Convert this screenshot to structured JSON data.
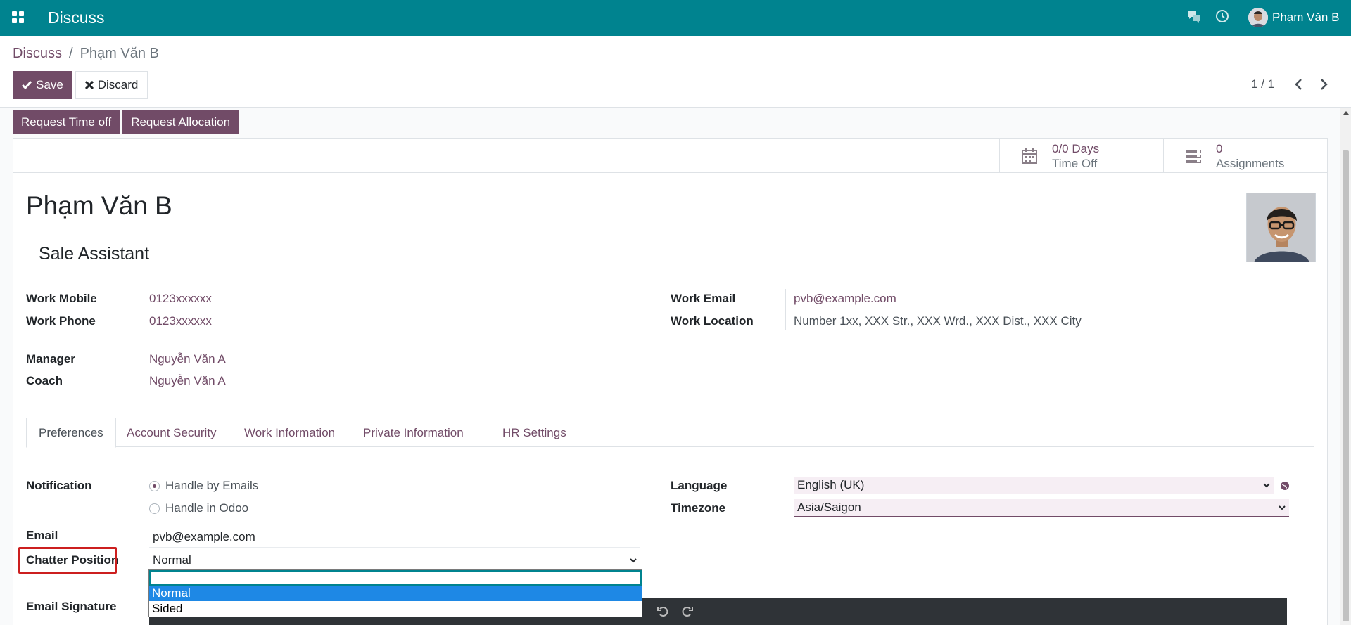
{
  "navbar": {
    "app_title": "Discuss",
    "user_name": "Phạm Văn B"
  },
  "breadcrumb": {
    "parent": "Discuss",
    "separator": "/",
    "current": "Phạm Văn B"
  },
  "actions": {
    "save_label": "Save",
    "discard_label": "Discard"
  },
  "pager": {
    "value": "1 / 1"
  },
  "statusbar": {
    "request_time_off": "Request Time off",
    "request_allocation": "Request Allocation"
  },
  "stat_buttons": {
    "time_off_value": "0/0 Days",
    "time_off_label": "Time Off",
    "assignments_value": "0",
    "assignments_label": "Assignments"
  },
  "employee": {
    "name": "Phạm Văn B",
    "job_title": "Sale Assistant"
  },
  "fields": {
    "work_mobile_label": "Work Mobile",
    "work_mobile": "0123xxxxxx",
    "work_phone_label": "Work Phone",
    "work_phone": "0123xxxxxx",
    "manager_label": "Manager",
    "manager": "Nguyễn Văn A",
    "coach_label": "Coach",
    "coach": "Nguyễn Văn A",
    "work_email_label": "Work Email",
    "work_email": "pvb@example.com",
    "work_location_label": "Work Location",
    "work_location": "Number 1xx, XXX Str., XXX Wrd., XXX Dist., XXX City"
  },
  "tabs": [
    {
      "label": "Preferences"
    },
    {
      "label": "Account Security"
    },
    {
      "label": "Work Information"
    },
    {
      "label": "Private Information"
    },
    {
      "label": "HR Settings"
    }
  ],
  "preferences": {
    "notification_label": "Notification",
    "notification_options": [
      "Handle by Emails",
      "Handle in Odoo"
    ],
    "email_label": "Email",
    "email": "pvb@example.com",
    "chatter_label": "Chatter Position",
    "chatter_value": "Normal",
    "signature_label": "Email Signature",
    "language_label": "Language",
    "language": "English (UK)",
    "timezone_label": "Timezone",
    "timezone": "Asia/Saigon"
  },
  "chatter_dropdown": {
    "options": [
      "Normal",
      "Sided"
    ]
  },
  "colors": {
    "navbar": "#00838f",
    "primary": "#714b67",
    "highlight": "#cc1f1f",
    "selected_option": "#1e88e5"
  }
}
